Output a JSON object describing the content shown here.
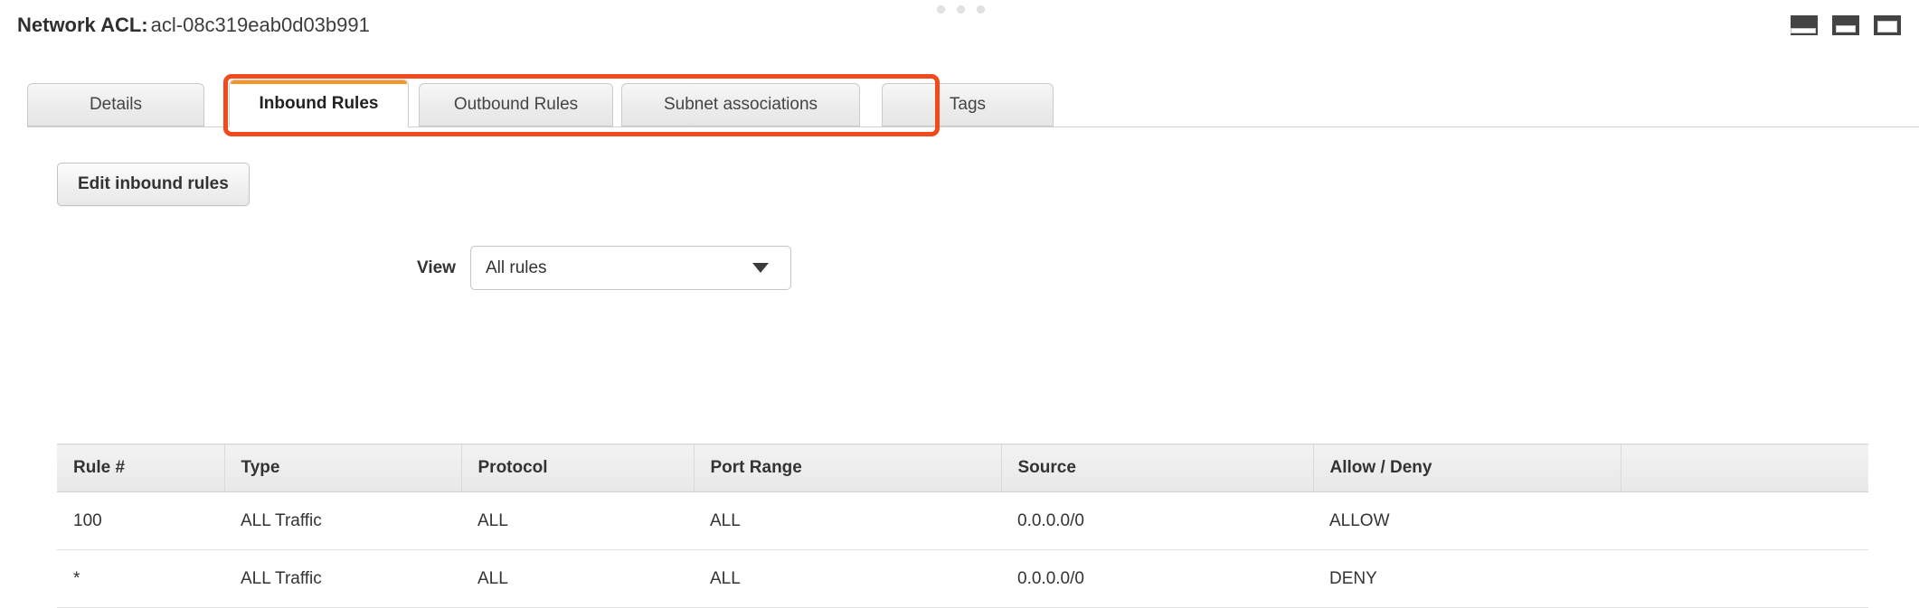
{
  "window": {
    "grip_dots": 3,
    "layout_icons": [
      {
        "name": "layout-bottom-pane-small-icon"
      },
      {
        "name": "layout-bottom-pane-medium-icon"
      },
      {
        "name": "layout-bottom-pane-large-icon"
      }
    ]
  },
  "header": {
    "label": "Network ACL:",
    "value": "acl-08c319eab0d03b991"
  },
  "tabs": [
    {
      "key": "details",
      "label": "Details",
      "active": false
    },
    {
      "key": "inbound",
      "label": "Inbound Rules",
      "active": true
    },
    {
      "key": "outbound",
      "label": "Outbound Rules",
      "active": false
    },
    {
      "key": "subnet",
      "label": "Subnet associations",
      "active": false
    },
    {
      "key": "tags",
      "label": "Tags",
      "active": false
    }
  ],
  "annotation": {
    "type": "highlight-box",
    "color": "#f4481d",
    "covers": "Inbound Rules, Outbound Rules, Subnet associations tabs"
  },
  "toolbar": {
    "edit_button_label": "Edit inbound rules"
  },
  "filter": {
    "view_label": "View",
    "view_value": "All rules",
    "view_options": [
      "All rules"
    ]
  },
  "table": {
    "columns": [
      "Rule #",
      "Type",
      "Protocol",
      "Port Range",
      "Source",
      "Allow / Deny",
      ""
    ],
    "rows": [
      {
        "rule": "100",
        "type": "ALL Traffic",
        "protocol": "ALL",
        "port_range": "ALL",
        "source": "0.0.0.0/0",
        "action": "ALLOW",
        "action_color": "#16a02c",
        "blank": ""
      },
      {
        "rule": "*",
        "type": "ALL Traffic",
        "protocol": "ALL",
        "port_range": "ALL",
        "source": "0.0.0.0/0",
        "action": "DENY",
        "action_color": "#c9000b",
        "blank": ""
      }
    ]
  },
  "colors": {
    "accent_orange": "#f79324",
    "annotation_red": "#f4481d",
    "allow_green": "#16a02c",
    "deny_red": "#c9000b"
  }
}
